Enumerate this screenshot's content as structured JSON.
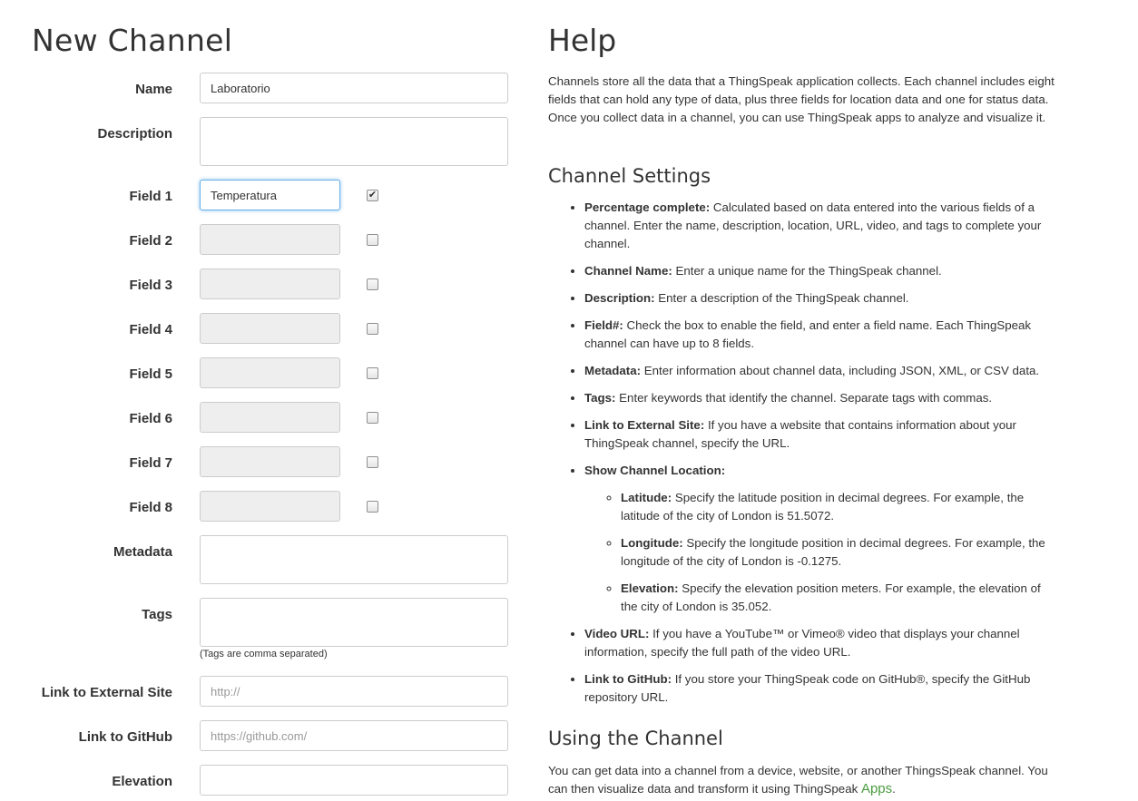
{
  "form": {
    "title": "New Channel",
    "name_label": "Name",
    "name_value": "Laboratorio",
    "description_label": "Description",
    "description_value": "",
    "fields": [
      {
        "label": "Field 1",
        "value": "Temperatura",
        "checked": true
      },
      {
        "label": "Field 2",
        "value": "",
        "checked": false
      },
      {
        "label": "Field 3",
        "value": "",
        "checked": false
      },
      {
        "label": "Field 4",
        "value": "",
        "checked": false
      },
      {
        "label": "Field 5",
        "value": "",
        "checked": false
      },
      {
        "label": "Field 6",
        "value": "",
        "checked": false
      },
      {
        "label": "Field 7",
        "value": "",
        "checked": false
      },
      {
        "label": "Field 8",
        "value": "",
        "checked": false
      }
    ],
    "metadata_label": "Metadata",
    "tags_label": "Tags",
    "tags_hint": "(Tags are comma separated)",
    "external_label": "Link to External Site",
    "external_placeholder": "http://",
    "github_label": "Link to GitHub",
    "github_placeholder": "https://github.com/",
    "elevation_label": "Elevation"
  },
  "help": {
    "title": "Help",
    "intro": "Channels store all the data that a ThingSpeak application collects. Each channel includes eight fields that can hold any type of data, plus three fields for location data and one for status data. Once you collect data in a channel, you can use ThingSpeak apps to analyze and visualize it.",
    "settings_heading": "Channel Settings",
    "items": [
      {
        "term": "Percentage complete:",
        "text": " Calculated based on data entered into the various fields of a channel. Enter the name, description, location, URL, video, and tags to complete your channel."
      },
      {
        "term": "Channel Name:",
        "text": " Enter a unique name for the ThingSpeak channel."
      },
      {
        "term": "Description:",
        "text": " Enter a description of the ThingSpeak channel."
      },
      {
        "term": "Field#:",
        "text": " Check the box to enable the field, and enter a field name. Each ThingSpeak channel can have up to 8 fields."
      },
      {
        "term": "Metadata:",
        "text": " Enter information about channel data, including JSON, XML, or CSV data."
      },
      {
        "term": "Tags:",
        "text": " Enter keywords that identify the channel. Separate tags with commas."
      },
      {
        "term": "Link to External Site:",
        "text": " If you have a website that contains information about your ThingSpeak channel, specify the URL."
      },
      {
        "term": "Show Channel Location:",
        "text": ""
      }
    ],
    "location_items": [
      {
        "term": "Latitude:",
        "text": " Specify the latitude position in decimal degrees. For example, the latitude of the city of London is 51.5072."
      },
      {
        "term": "Longitude:",
        "text": " Specify the longitude position in decimal degrees. For example, the longitude of the city of London is -0.1275."
      },
      {
        "term": "Elevation:",
        "text": " Specify the elevation position meters. For example, the elevation of the city of London is 35.052."
      }
    ],
    "tail_items": [
      {
        "term": "Video URL:",
        "text": " If you have a YouTube™ or Vimeo® video that displays your channel information, specify the full path of the video URL."
      },
      {
        "term": "Link to GitHub:",
        "text": " If you store your ThingSpeak code on GitHub®, specify the GitHub repository URL."
      }
    ],
    "using_heading": "Using the Channel",
    "using_text": "You can get data into a channel from a device, website, or another ThingsSpeak channel. You can then visualize data and transform it using ThingSpeak ",
    "apps_link": "Apps",
    "using_end": "."
  }
}
